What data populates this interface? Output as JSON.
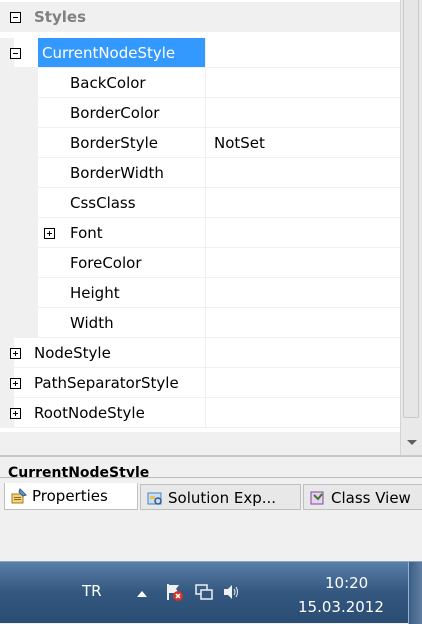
{
  "grid": {
    "category": "Styles",
    "selected": "CurrentNodeStyle",
    "rows": [
      {
        "name": "BackColor",
        "value": ""
      },
      {
        "name": "BorderColor",
        "value": ""
      },
      {
        "name": "BorderStyle",
        "value": "NotSet"
      },
      {
        "name": "BorderWidth",
        "value": ""
      },
      {
        "name": "CssClass",
        "value": ""
      },
      {
        "name": "Font",
        "value": ""
      },
      {
        "name": "ForeColor",
        "value": ""
      },
      {
        "name": "Height",
        "value": ""
      },
      {
        "name": "Width",
        "value": ""
      }
    ],
    "top_rows": [
      {
        "name": "NodeStyle"
      },
      {
        "name": "PathSeparatorStyle"
      },
      {
        "name": "RootNodeStyle"
      }
    ]
  },
  "description": {
    "title": "CurrentNodeStyle"
  },
  "tabs": [
    {
      "label": "Properties",
      "icon": "properties-icon"
    },
    {
      "label": "Solution Exp...",
      "icon": "solution-explorer-icon"
    },
    {
      "label": "Class View",
      "icon": "class-view-icon"
    }
  ],
  "taskbar": {
    "language": "TR",
    "time": "10:20",
    "date": "15.03.2012"
  }
}
